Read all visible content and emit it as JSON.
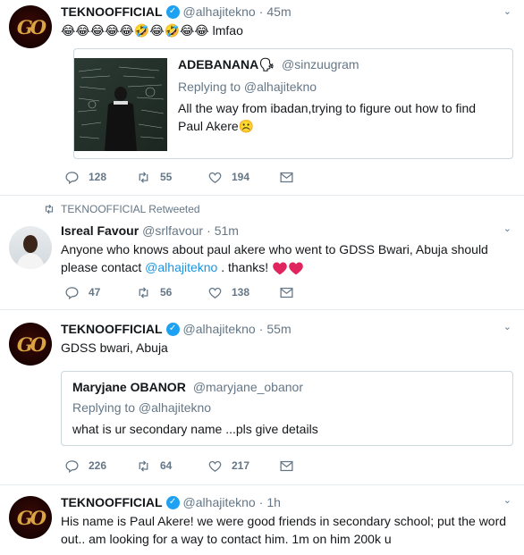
{
  "tweets": [
    {
      "name": "TEKNOOFFICIAL",
      "handle": "@alhajitekno",
      "time": "45m",
      "text": "😂😂😂😂😂🤣😂🤣😂😂 lmfao",
      "quote": {
        "name": "ADEBANANA🗣",
        "handle": "@sinzuugram",
        "replying": "Replying to @alhajitekno",
        "text": "All the way from ibadan,trying to figure out how to find Paul Akere☹️"
      },
      "replies": "128",
      "retweets": "55",
      "likes": "194"
    },
    {
      "retweeted_by": "TEKNOOFFICIAL Retweeted",
      "name": "Isreal Favour",
      "handle": "@srlfavour",
      "time": "51m",
      "text_before": "Anyone who knows about paul akere who went to GDSS Bwari,  Abuja should please contact ",
      "mention": "@alhajitekno",
      "text_after": " . thanks! ",
      "replies": "47",
      "retweets": "56",
      "likes": "138"
    },
    {
      "name": "TEKNOOFFICIAL",
      "handle": "@alhajitekno",
      "time": "55m",
      "text": "GDSS bwari, Abuja",
      "quote": {
        "name": "Maryjane OBANOR",
        "handle": "@maryjane_obanor",
        "replying": "Replying to @alhajitekno",
        "text": "what is ur secondary name ...pls give details"
      },
      "replies": "226",
      "retweets": "64",
      "likes": "217"
    },
    {
      "name": "TEKNOOFFICIAL",
      "handle": "@alhajitekno",
      "time": "1h",
      "text": "His name is Paul Akere! we were good friends in secondary school; put the word out.. am looking for a way to contact him. 1m on him 200k u"
    }
  ],
  "avatar_logo": "GO",
  "colors": {
    "accent": "#1da1f2",
    "heart": "#e0245e",
    "muted": "#657786"
  }
}
